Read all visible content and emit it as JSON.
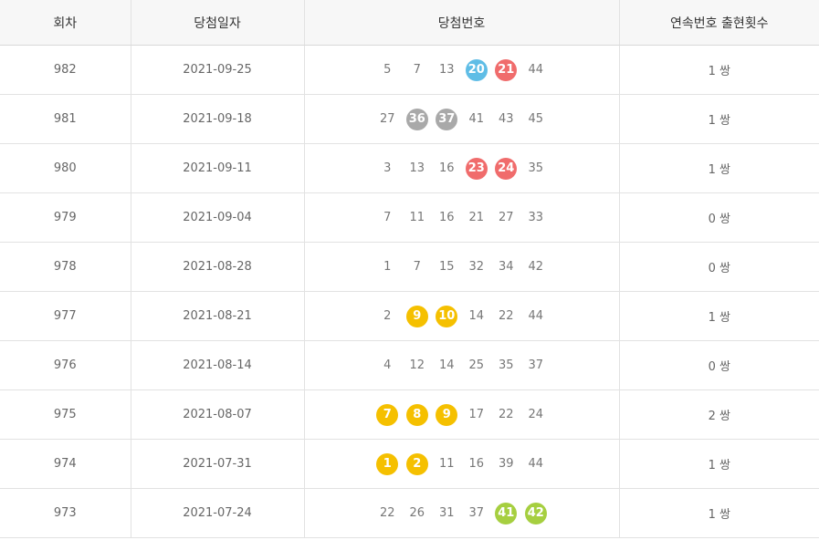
{
  "headers": {
    "round": "회차",
    "date": "당첨일자",
    "numbers": "당첨번호",
    "consecutive": "연속번호 출현횟수"
  },
  "ball_colors": {
    "yellow": "#f5c000",
    "blue": "#5fbde6",
    "red": "#f06c6c",
    "gray": "#a9a9a9",
    "green": "#a6cf40"
  },
  "rows": [
    {
      "round": "982",
      "date": "2021-09-25",
      "numbers": [
        {
          "n": "5"
        },
        {
          "n": "7"
        },
        {
          "n": "13"
        },
        {
          "n": "20",
          "ball": "blue"
        },
        {
          "n": "21",
          "ball": "red"
        },
        {
          "n": "44"
        }
      ],
      "consecutive": "1 쌍"
    },
    {
      "round": "981",
      "date": "2021-09-18",
      "numbers": [
        {
          "n": "27"
        },
        {
          "n": "36",
          "ball": "gray"
        },
        {
          "n": "37",
          "ball": "gray"
        },
        {
          "n": "41"
        },
        {
          "n": "43"
        },
        {
          "n": "45"
        }
      ],
      "consecutive": "1 쌍"
    },
    {
      "round": "980",
      "date": "2021-09-11",
      "numbers": [
        {
          "n": "3"
        },
        {
          "n": "13"
        },
        {
          "n": "16"
        },
        {
          "n": "23",
          "ball": "red"
        },
        {
          "n": "24",
          "ball": "red"
        },
        {
          "n": "35"
        }
      ],
      "consecutive": "1 쌍"
    },
    {
      "round": "979",
      "date": "2021-09-04",
      "numbers": [
        {
          "n": "7"
        },
        {
          "n": "11"
        },
        {
          "n": "16"
        },
        {
          "n": "21"
        },
        {
          "n": "27"
        },
        {
          "n": "33"
        }
      ],
      "consecutive": "0 쌍"
    },
    {
      "round": "978",
      "date": "2021-08-28",
      "numbers": [
        {
          "n": "1"
        },
        {
          "n": "7"
        },
        {
          "n": "15"
        },
        {
          "n": "32"
        },
        {
          "n": "34"
        },
        {
          "n": "42"
        }
      ],
      "consecutive": "0 쌍"
    },
    {
      "round": "977",
      "date": "2021-08-21",
      "numbers": [
        {
          "n": "2"
        },
        {
          "n": "9",
          "ball": "yellow"
        },
        {
          "n": "10",
          "ball": "yellow"
        },
        {
          "n": "14"
        },
        {
          "n": "22"
        },
        {
          "n": "44"
        }
      ],
      "consecutive": "1 쌍"
    },
    {
      "round": "976",
      "date": "2021-08-14",
      "numbers": [
        {
          "n": "4"
        },
        {
          "n": "12"
        },
        {
          "n": "14"
        },
        {
          "n": "25"
        },
        {
          "n": "35"
        },
        {
          "n": "37"
        }
      ],
      "consecutive": "0 쌍"
    },
    {
      "round": "975",
      "date": "2021-08-07",
      "numbers": [
        {
          "n": "7",
          "ball": "yellow"
        },
        {
          "n": "8",
          "ball": "yellow"
        },
        {
          "n": "9",
          "ball": "yellow"
        },
        {
          "n": "17"
        },
        {
          "n": "22"
        },
        {
          "n": "24"
        }
      ],
      "consecutive": "2 쌍"
    },
    {
      "round": "974",
      "date": "2021-07-31",
      "numbers": [
        {
          "n": "1",
          "ball": "yellow"
        },
        {
          "n": "2",
          "ball": "yellow"
        },
        {
          "n": "11"
        },
        {
          "n": "16"
        },
        {
          "n": "39"
        },
        {
          "n": "44"
        }
      ],
      "consecutive": "1 쌍"
    },
    {
      "round": "973",
      "date": "2021-07-24",
      "numbers": [
        {
          "n": "22"
        },
        {
          "n": "26"
        },
        {
          "n": "31"
        },
        {
          "n": "37"
        },
        {
          "n": "41",
          "ball": "green"
        },
        {
          "n": "42",
          "ball": "green"
        }
      ],
      "consecutive": "1 쌍"
    }
  ]
}
